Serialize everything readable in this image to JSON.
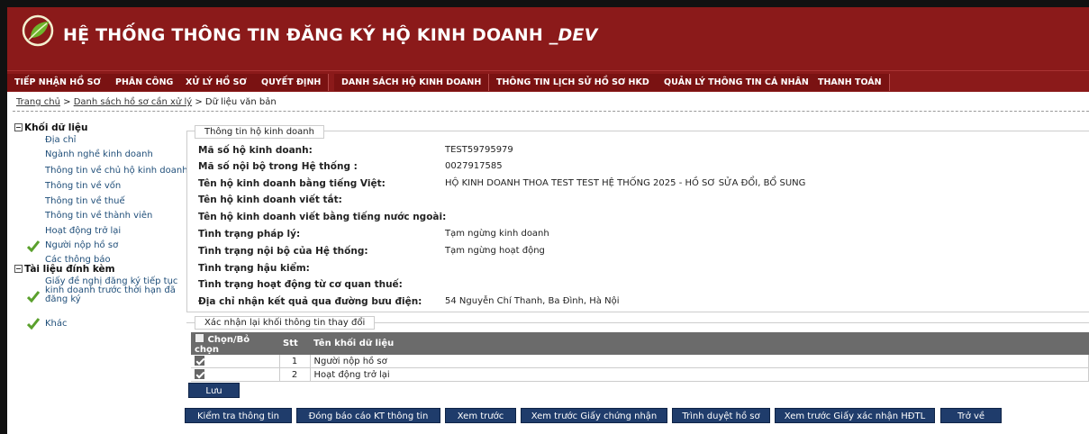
{
  "header": {
    "title": "HỆ THỐNG THÔNG TIN ĐĂNG KÝ HỘ KINH DOANH",
    "env": "_DEV",
    "brand_color": "#8b1a1a"
  },
  "menu": [
    {
      "label": "TIẾP NHẬN HỒ SƠ"
    },
    {
      "label": "PHÂN CÔNG"
    },
    {
      "label": "XỬ LÝ HỒ SƠ"
    },
    {
      "label": "QUYẾT ĐỊNH"
    },
    {
      "label": "DANH SÁCH HỘ KINH DOANH"
    },
    {
      "label": "THÔNG TIN LỊCH SỬ HỒ SƠ HKD"
    },
    {
      "label": "QUẢN LÝ THÔNG TIN CÁ NHÂN"
    },
    {
      "label": "THANH TOÁN"
    }
  ],
  "breadcrumb": {
    "home": "Trang chủ",
    "sep": ">",
    "list": "Danh sách hồ sơ cần xử lý",
    "current": "Dữ liệu văn bản"
  },
  "sidebar": {
    "group1": "Khối dữ liệu",
    "group1_items": [
      "Địa chỉ",
      "Ngành nghề kinh doanh",
      "Thông tin về chủ hộ kinh doanh",
      "Thông tin về vốn",
      "Thông tin về thuế",
      "Thông tin về thành viên",
      "Hoạt động trở lại",
      "Người nộp hồ sơ",
      "Các thông báo"
    ],
    "group2": "Tài liệu đính kèm",
    "group2_items": [
      "Giấy đề nghị đăng ký tiếp tục kinh doanh trước thời hạn đã đăng ký",
      "Khác"
    ]
  },
  "info": {
    "legend": "Thông tin hộ kinh doanh",
    "rows": [
      {
        "label": "Mã số hộ kinh doanh:",
        "value": "TEST59795979"
      },
      {
        "label": "Mã số nội bộ trong Hệ thống :",
        "value": "0027917585"
      },
      {
        "label": "Tên hộ kinh doanh bằng tiếng Việt:",
        "value": "HỘ KINH DOANH THOA TEST TEST HỆ THỐNG 2025 - HỒ SƠ SỬA ĐỔI, BỔ SUNG"
      },
      {
        "label": "Tên hộ kinh doanh viết tắt:",
        "value": ""
      },
      {
        "label": "Tên hộ kinh doanh viết bằng tiếng nước ngoài:",
        "value": ""
      },
      {
        "label": "Tình trạng pháp lý:",
        "value": "Tạm ngừng kinh doanh"
      },
      {
        "label": "Tình trạng nội bộ của Hệ thống:",
        "value": "Tạm ngừng hoạt động"
      },
      {
        "label": "Tình trạng hậu kiểm:",
        "value": ""
      },
      {
        "label": "Tình trạng hoạt động từ cơ quan thuế:",
        "value": ""
      },
      {
        "label": "Địa chỉ nhận kết quả qua đường bưu điện:",
        "value": "54 Nguyễn Chí Thanh, Ba Đình, Hà Nội"
      }
    ]
  },
  "confirm": {
    "legend": "Xác nhận lại khối thông tin thay đổi",
    "columns": [
      "Chọn/Bỏ chọn",
      "Stt",
      "Tên khối dữ liệu"
    ],
    "rows": [
      {
        "stt": "1",
        "name": "Người nộp hồ sơ",
        "checked": true
      },
      {
        "stt": "2",
        "name": "Hoạt động trở lại",
        "checked": true
      }
    ],
    "save": "Lưu"
  },
  "actions": [
    "Kiểm tra thông tin",
    "Đóng báo cáo KT thông tin",
    "Xem trước",
    "Xem trước Giấy chứng nhận",
    "Trình duyệt hồ sơ",
    "Xem trước Giấy xác nhận HĐTL",
    "Trở về"
  ]
}
